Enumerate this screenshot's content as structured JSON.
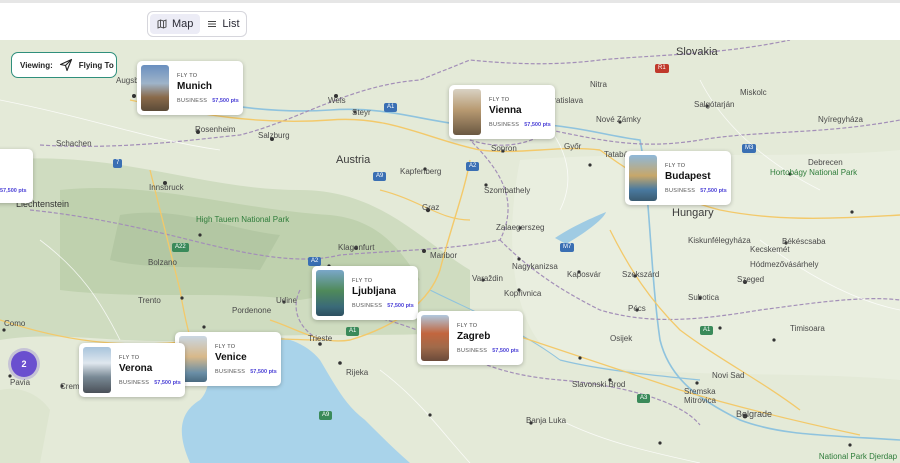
{
  "view_toggle": {
    "map_label": "Map",
    "list_label": "List",
    "selected": "Map",
    "map_icon": "map-icon",
    "list_icon": "list-icon"
  },
  "viewing": {
    "label": "Viewing:",
    "value": "Flying To",
    "icon": "plane-icon"
  },
  "cluster_count": "2",
  "destinations": [
    {
      "fly_to": "FLY TO",
      "city": "Munich",
      "class": "BUSINESS",
      "points": "57,500 pts"
    },
    {
      "fly_to": "FLY TO",
      "city": "Vienna",
      "class": "BUSINESS",
      "points": "57,500 pts"
    },
    {
      "fly_to": "FLY TO",
      "city": "Budapest",
      "class": "BUSINESS",
      "points": "57,500 pts"
    },
    {
      "fly_to": "FLY TO",
      "city": "Ljubljana",
      "class": "BUSINESS",
      "points": "57,500 pts"
    },
    {
      "fly_to": "FLY TO",
      "city": "Zagreb",
      "class": "BUSINESS",
      "points": "57,500 pts"
    },
    {
      "fly_to": "FLY TO",
      "city": "Verona",
      "class": "BUSINESS",
      "points": "57,500 pts"
    },
    {
      "fly_to": "FLY TO",
      "city": "Venice",
      "class": "BUSINESS",
      "points": "57,500 pts"
    },
    {
      "fly_to": "FLY TO",
      "city": "",
      "class": "",
      "points": "57,500 pts"
    }
  ],
  "map_labels": {
    "countries": [
      "Austria",
      "Hungary",
      "Slovakia",
      "Liechtenstein"
    ],
    "parks": [
      "High Tauern National Park",
      "Hortobágy National Park",
      "National Park Djerdap"
    ],
    "cities": [
      "Augsburg",
      "Rosenheim",
      "Salzburg",
      "Schachen",
      "Innsbruck",
      "Wels",
      "Steyr",
      "Linz",
      "Kapfenberg",
      "Graz",
      "Klagenfurt",
      "Villach",
      "Maribor",
      "Sopron",
      "Szombathely",
      "Zalaegerszeg",
      "Nagykanizsa",
      "Varaždin",
      "Koprivnica",
      "Kaposvár",
      "Szekszárd",
      "Pécs",
      "Szeged",
      "Subotica",
      "Novi Sad",
      "Osijek",
      "Slavonski Brod",
      "Belgrade",
      "Sremska Mitrovica",
      "Banja Luka",
      "Bolzano",
      "Trento",
      "Udine",
      "Pordenone",
      "Trieste",
      "Rijeka",
      "Como",
      "Pavia",
      "Cremona",
      "Kecskemét",
      "Békéscsaba",
      "Timisoara",
      "Székesfehérvár",
      "Tatabánya",
      "Győr",
      "Nové Zámky",
      "Nitra",
      "Salgótarján",
      "Miskolc",
      "Nyíregyháza",
      "Debrecen",
      "Kiskunfélegyháza",
      "Hódmezővásárhely",
      "Tatabánya",
      "Bratislava"
    ],
    "shields": [
      "A1",
      "A2",
      "A9",
      "A22",
      "M3",
      "M7",
      "R1",
      "7",
      "A3"
    ]
  }
}
